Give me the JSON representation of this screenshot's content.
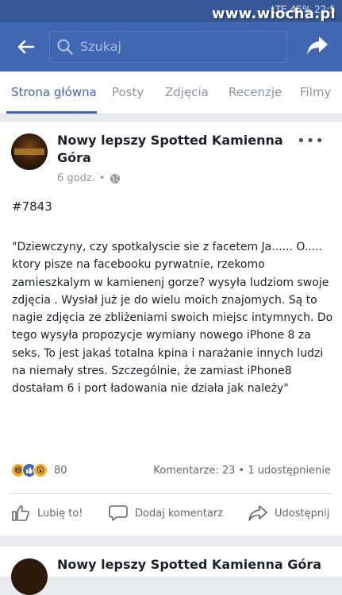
{
  "statusbar": {
    "text": "LTE 45% 22:5"
  },
  "watermark": "www.wiocha.pl",
  "navbar": {
    "search_placeholder": "Szukaj"
  },
  "tabs": [
    {
      "label": "Strona główna",
      "active": true
    },
    {
      "label": "Posty"
    },
    {
      "label": "Zdjęcia"
    },
    {
      "label": "Recenzje"
    },
    {
      "label": "Filmy"
    }
  ],
  "post": {
    "page_name": "Nowy lepszy Spotted Kamienna Góra",
    "time": "6 godz.",
    "hashtag": "#7843",
    "body": "\"Dziewczyny, czy spotkalyscie sie z facetem Ja...... O..... ktory pisze na facebooku pyrwatnie, rzekomo zamieszkalym w kamienenj gorze? wysyła ludziom swoje zdjęcia . Wysłał już je do wielu moich znajomych. Są to nagie zdjęcia ze zbliżeniami swoich miejsc intymnych. Do tego wysyła propozycje wymiany nowego iPhone 8 za seks. To jest jakaś totalna kpina i narażanie innych ludzi na niemały stres. Szczególnie, że zamiast iPhone8 dostałam 6 i port ładowania nie działa jak należy\"",
    "reaction_count": "80",
    "stats": "Komentarze: 23 • 1 udostępnienie",
    "actions": {
      "like": "Lubię to!",
      "comment": "Dodaj komentarz",
      "share": "Udostępnij"
    }
  },
  "next_post": {
    "page_name": "Nowy lepszy Spotted Kamienna Góra"
  },
  "colors": {
    "brand": "#4267b2",
    "text": "#1d2129",
    "muted": "#90949c"
  }
}
